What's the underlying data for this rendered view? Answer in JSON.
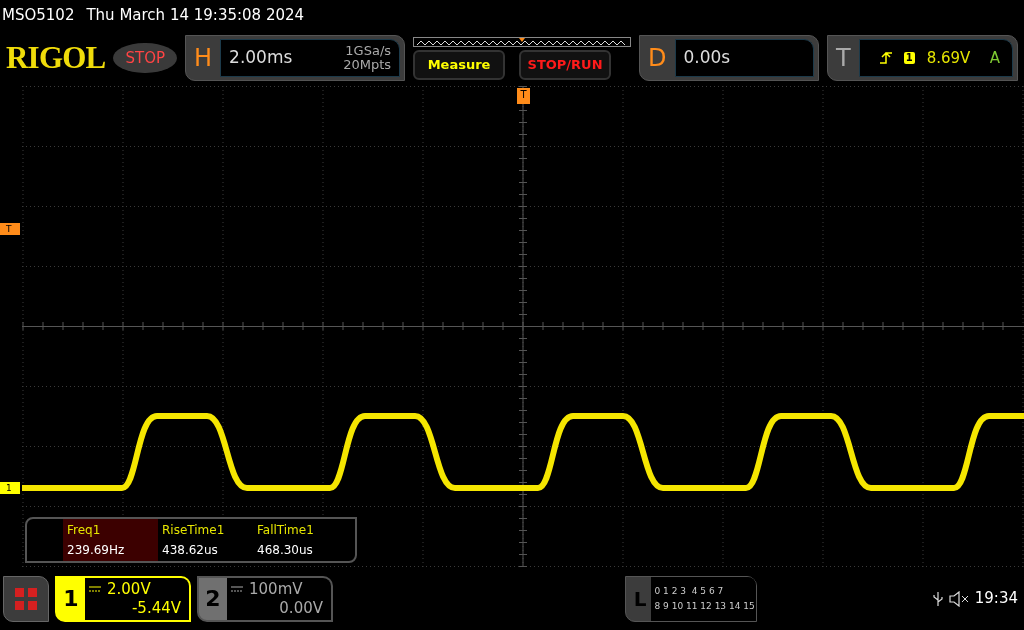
{
  "title_bar": {
    "model": "MSO5102",
    "datetime": "Thu March 14 19:35:08 2024"
  },
  "header": {
    "logo": "RIGOL",
    "run_state": "STOP",
    "horizontal": {
      "letter": "H",
      "timebase": "2.00ms",
      "sample_rate": "1GSa/s",
      "memory_depth": "20Mpts"
    },
    "buttons": [
      {
        "label": "Measure",
        "kind": "measure"
      },
      {
        "label": "STOP/RUN",
        "kind": "stoprun"
      }
    ],
    "delay": {
      "letter": "D",
      "value": "0.00s"
    },
    "trigger": {
      "letter": "T",
      "source": "1",
      "level": "8.69V",
      "mode": "A"
    }
  },
  "screen": {
    "trigger_marker": "T",
    "trigger_position_marker": "T",
    "channel_marker": "1",
    "measurements": [
      {
        "name": "Freq1",
        "value": "239.69Hz",
        "selected": true
      },
      {
        "name": "RiseTime1",
        "value": "438.62us",
        "selected": false
      },
      {
        "name": "FallTime1",
        "value": "468.30us",
        "selected": false
      }
    ]
  },
  "channels": [
    {
      "number": "1",
      "scale": "2.00V",
      "offset": "-5.44V",
      "selected": true
    },
    {
      "number": "2",
      "scale": "100mV",
      "offset": "0.00V",
      "selected": false
    }
  ],
  "logic": {
    "letter": "L",
    "rows": [
      "0 1 2 3  4 5 6 7",
      "8 9 10 11 12 13 14 15"
    ]
  },
  "status": {
    "time": "19:34"
  }
}
